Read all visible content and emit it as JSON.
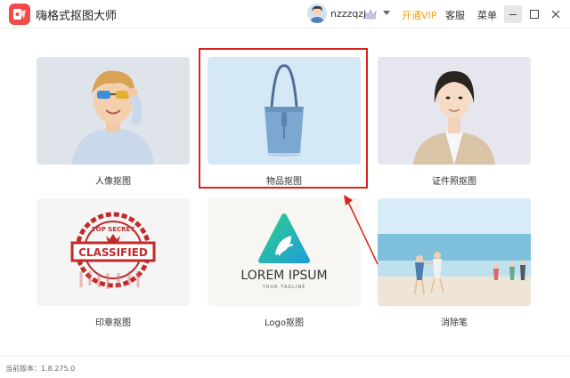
{
  "app": {
    "title": "嗨格式抠图大师",
    "brand_color": "#f04a4a"
  },
  "header": {
    "username": "nzzzqzj",
    "open_vip": "开通VIP",
    "service": "客服",
    "menu": "菜单",
    "vip_color": "#f0a21b"
  },
  "cards": [
    {
      "label": "人像抠图",
      "image": "boy-with-sunglasses-photo"
    },
    {
      "label": "物品抠图",
      "image": "blue-tote-bag-photo",
      "highlighted": true
    },
    {
      "label": "证件照抠图",
      "image": "woman-portrait-photo"
    },
    {
      "label": "印章抠图",
      "image": "classified-stamp-image",
      "stamp_text": "CLASSIFIED",
      "stamp_top": "TOP SECRET"
    },
    {
      "label": "Logo抠图",
      "image": "lorem-ipsum-logo-image",
      "logo_text": "LOREM IPSUM",
      "logo_tagline": "YOUR TAGLINE"
    },
    {
      "label": "消除笔",
      "image": "beach-people-photo"
    }
  ],
  "annotation": {
    "highlight_color": "#d9231f"
  },
  "status": {
    "version": "当前版本：1.8.275.0"
  }
}
